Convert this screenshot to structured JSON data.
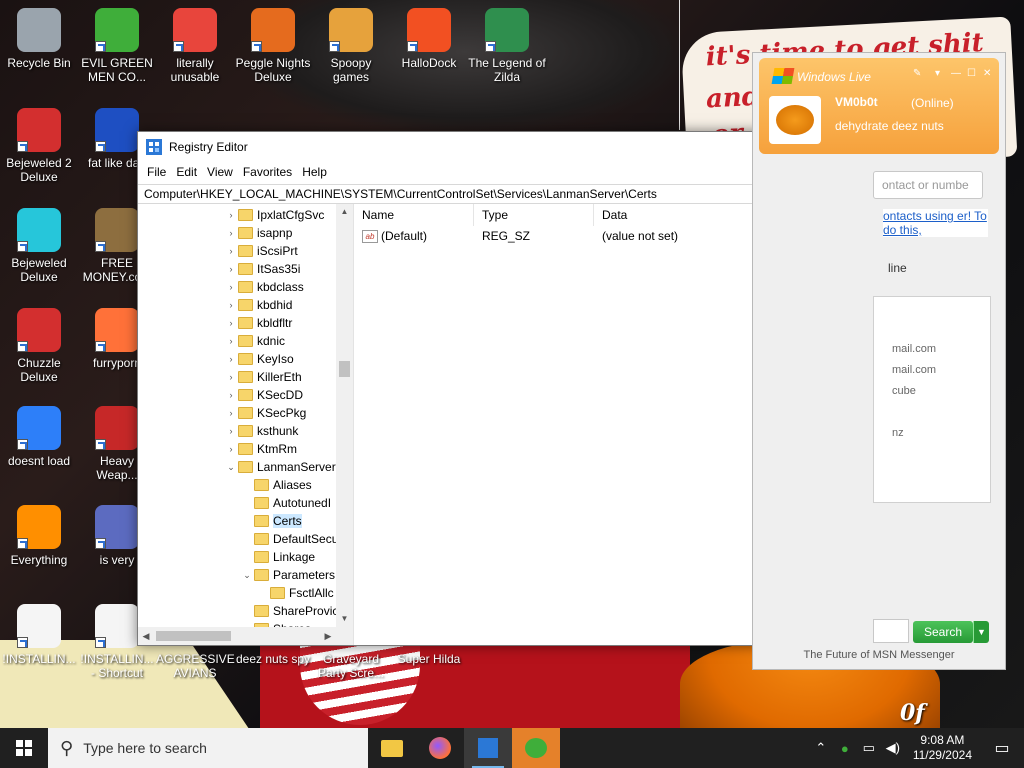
{
  "wallpaper": {
    "sign_lines": [
      "it's time to get shit",
      "and",
      "or t"
    ],
    "bottom_text": "0f"
  },
  "desktop_icons": [
    {
      "label": "Recycle Bin",
      "icon": "recycle-bin-icon",
      "color": "#9aa4ad"
    },
    {
      "label": "EVIL GREEN MEN CO...",
      "icon": "msn-people-icon",
      "color": "#3fae3a"
    },
    {
      "label": "literally unusable",
      "icon": "chrome-icon",
      "color": "#e8453c"
    },
    {
      "label": "Peggle Nights Deluxe",
      "icon": "peggle-icon",
      "color": "#e56b1e"
    },
    {
      "label": "Spoopy games",
      "icon": "folder-games-icon",
      "color": "#e6a23c"
    },
    {
      "label": "HalloDock",
      "icon": "windows-logo-icon",
      "color": "#f25022"
    },
    {
      "label": "The Legend of Zilda",
      "icon": "zelda-character-icon",
      "color": "#2f8f4e"
    },
    {
      "label": "Bejeweled 2 Deluxe",
      "icon": "bejeweled2-icon",
      "color": "#d32f2f"
    },
    {
      "label": "fat like darl",
      "icon": "mpl-icon",
      "color": "#1e4fc2"
    },
    {
      "label": "Bejeweled Deluxe",
      "icon": "diamond-icon",
      "color": "#26c6da"
    },
    {
      "label": "FREE MONEY.com",
      "icon": "money-bag-icon",
      "color": "#8d6e3f"
    },
    {
      "label": "Chuzzle Deluxe",
      "icon": "chuzzle-icon",
      "color": "#d32f2f"
    },
    {
      "label": "furryporn",
      "icon": "firefox-icon",
      "color": "#ff7139"
    },
    {
      "label": "doesnt load",
      "icon": "thunderbird-icon",
      "color": "#2d7ff9"
    },
    {
      "label": "Heavy Weap...",
      "icon": "radiation-icon",
      "color": "#c62828"
    },
    {
      "label": "Everything",
      "icon": "magnifier-icon",
      "color": "#ff8f00"
    },
    {
      "label": "is very",
      "icon": "shield-logo-icon",
      "color": "#5c6bc0"
    },
    {
      "label": "!INSTALLIN...",
      "icon": "text-document-icon",
      "color": "#f5f5f5"
    },
    {
      "label": "!INSTALLIN... - Shortcut",
      "icon": "text-document-icon",
      "color": "#f5f5f5"
    },
    {
      "label": "AGGRESSIVE AVIANS",
      "icon": "",
      "color": ""
    },
    {
      "label": "deez nuts spy",
      "icon": "",
      "color": ""
    },
    {
      "label": "Graveyard Party Scre...",
      "icon": "",
      "color": ""
    },
    {
      "label": "Super Hilda",
      "icon": "",
      "color": ""
    }
  ],
  "regedit": {
    "title": "Registry Editor",
    "menu": [
      "File",
      "Edit",
      "View",
      "Favorites",
      "Help"
    ],
    "address": "Computer\\HKEY_LOCAL_MACHINE\\SYSTEM\\CurrentControlSet\\Services\\LanmanServer\\Certs",
    "tree": [
      {
        "label": "IpxlatCfgSvc",
        "exp": ">",
        "level": 0
      },
      {
        "label": "isapnp",
        "exp": ">",
        "level": 0
      },
      {
        "label": "iScsiPrt",
        "exp": ">",
        "level": 0
      },
      {
        "label": "ItSas35i",
        "exp": ">",
        "level": 0
      },
      {
        "label": "kbdclass",
        "exp": ">",
        "level": 0
      },
      {
        "label": "kbdhid",
        "exp": ">",
        "level": 0
      },
      {
        "label": "kbldfltr",
        "exp": ">",
        "level": 0
      },
      {
        "label": "kdnic",
        "exp": ">",
        "level": 0
      },
      {
        "label": "KeyIso",
        "exp": ">",
        "level": 0
      },
      {
        "label": "KillerEth",
        "exp": ">",
        "level": 0
      },
      {
        "label": "KSecDD",
        "exp": ">",
        "level": 0
      },
      {
        "label": "KSecPkg",
        "exp": ">",
        "level": 0
      },
      {
        "label": "ksthunk",
        "exp": ">",
        "level": 0
      },
      {
        "label": "KtmRm",
        "exp": ">",
        "level": 0
      },
      {
        "label": "LanmanServer",
        "exp": "v",
        "level": 0
      },
      {
        "label": "Aliases",
        "exp": "",
        "level": 1
      },
      {
        "label": "AutotunedI",
        "exp": "",
        "level": 1
      },
      {
        "label": "Certs",
        "exp": "",
        "level": 1,
        "selected": true
      },
      {
        "label": "DefaultSecu",
        "exp": "",
        "level": 1
      },
      {
        "label": "Linkage",
        "exp": "",
        "level": 1
      },
      {
        "label": "Parameters",
        "exp": "v",
        "level": 1
      },
      {
        "label": "FsctlAllc",
        "exp": "",
        "level": 2
      },
      {
        "label": "ShareProvic",
        "exp": "",
        "level": 1
      },
      {
        "label": "Shares",
        "exp": ">",
        "level": 1
      }
    ],
    "columns": [
      "Name",
      "Type",
      "Data"
    ],
    "values": [
      {
        "name": "(Default)",
        "type": "REG_SZ",
        "data": "(value not set)",
        "icon": "string-value-icon"
      }
    ]
  },
  "msn": {
    "brand": "Windows Live",
    "username": "VM0b0t",
    "status": "(Online)",
    "personal_message": "dehydrate deez nuts",
    "search_placeholder": "ontact or numbe",
    "info_link": "ontacts using er! To do this,",
    "online_label": "line",
    "contacts": [
      "mail.com",
      "mail.com",
      "cube",
      "nz"
    ],
    "search_button": "Search",
    "footer": "The Future of MSN Messenger"
  },
  "taskbar": {
    "search_placeholder": "Type here to search",
    "time": "9:08 AM",
    "date": "11/29/2024",
    "apps": [
      {
        "name": "file-explorer-icon",
        "color": "#f2c744"
      },
      {
        "name": "firefox-icon",
        "color": "#ff7139"
      },
      {
        "name": "regedit-icon",
        "color": "#2b78d6"
      },
      {
        "name": "msn-messenger-icon",
        "color": "#3fae3a"
      }
    ]
  }
}
